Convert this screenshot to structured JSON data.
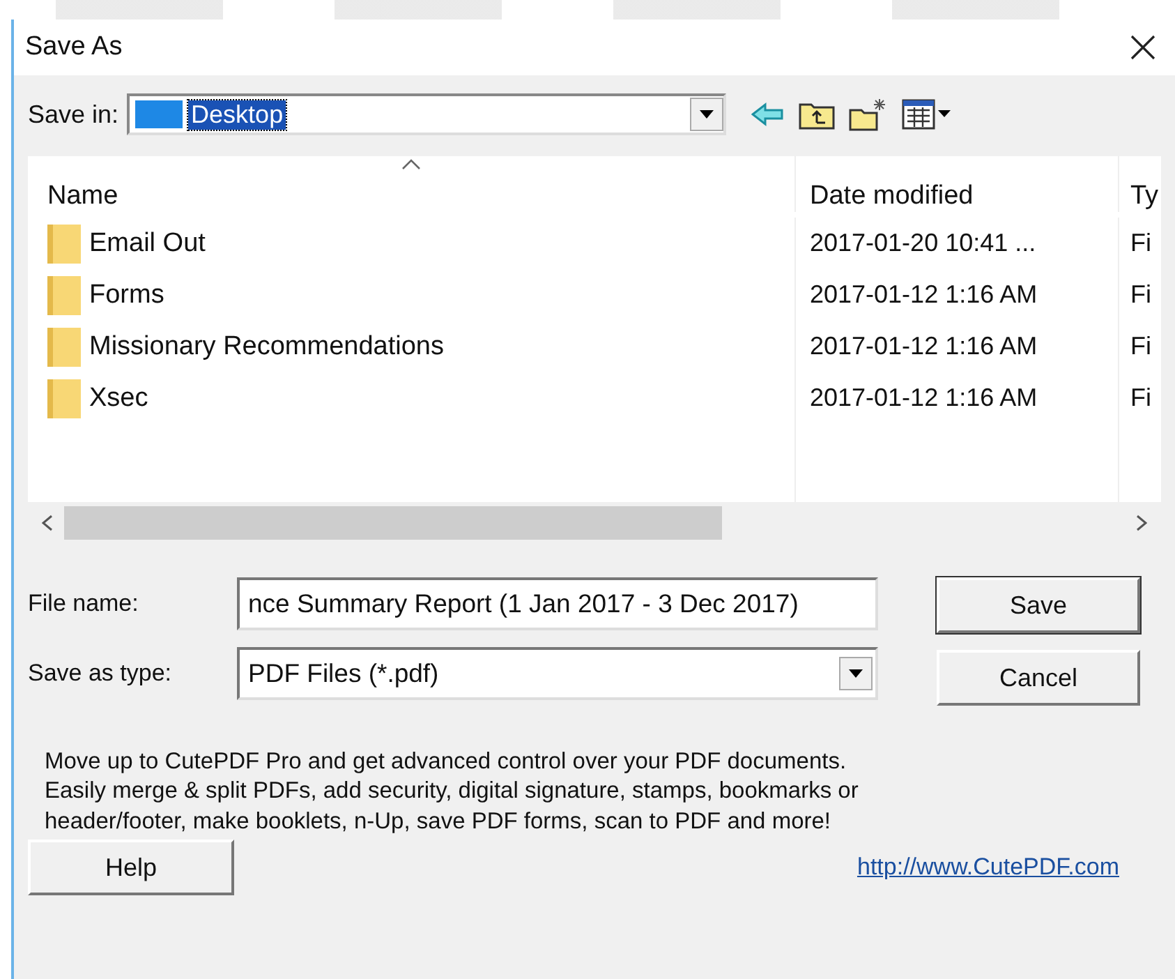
{
  "window": {
    "title": "Save As"
  },
  "save_in": {
    "label": "Save in:",
    "value": "Desktop"
  },
  "toolbar": [
    {
      "kind": "back"
    },
    {
      "kind": "up"
    },
    {
      "kind": "new_folder"
    },
    {
      "kind": "view"
    }
  ],
  "file_list": {
    "columns": [
      "Name",
      "Date modified",
      "Ty"
    ],
    "rows": [
      {
        "name": "Email Out",
        "date": "2017-01-20 10:41 ...",
        "type": "Fi"
      },
      {
        "name": "Forms",
        "date": "2017-01-12 1:16 AM",
        "type": "Fi"
      },
      {
        "name": "Missionary Recommendations",
        "date": "2017-01-12 1:16 AM",
        "type": "Fi"
      },
      {
        "name": "Xsec",
        "date": "2017-01-12 1:16 AM",
        "type": "Fi"
      }
    ]
  },
  "file_name": {
    "label": "File name:",
    "value": "nce Summary Report (1 Jan 2017 - 3 Dec 2017)"
  },
  "save_as_type": {
    "label": "Save as type:",
    "value": "PDF Files (*.pdf)"
  },
  "buttons": {
    "save": "Save",
    "cancel": "Cancel",
    "help": "Help"
  },
  "promo": [
    "Move up to CutePDF Pro and get advanced control over your PDF documents.",
    "Easily merge & split PDFs, add security, digital signature, stamps, bookmarks or",
    "header/footer, make booklets, n-Up, save PDF forms, scan to PDF and more!"
  ],
  "link": "http://www.CutePDF.com"
}
